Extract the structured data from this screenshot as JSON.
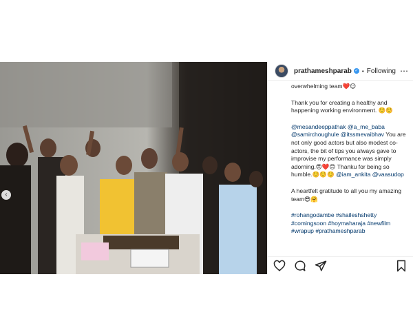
{
  "header": {
    "username": "prathameshparab",
    "dot": "•",
    "follow_label": "Following",
    "more_label": "⋯",
    "verified_glyph": "✓"
  },
  "media": {
    "prev_arrow": "‹"
  },
  "caption": {
    "line1": "overwhelming team❤️😊",
    "para2": "Thank you for creating a healthy and happening working environment. ☺️☺️",
    "mention1": "@mesandeeppathak",
    "mention2": "@a_me_baba",
    "mention3": "@samirchoughule",
    "mention4": "@itssmevaibhav",
    "para3_text": "You are not only good actors but also modest co-actors, the bit of tips you always gave to improvise my performance was simply adorning.😍❤️😊 Thanku for being so humble.☺️☺️☺️",
    "mention5": "@iam_ankita",
    "mention6": "@vaasudop",
    "para4": "A heartfelt gratitude to all you my amazing team😎🤗",
    "tag1": "#rohangodambe",
    "tag2": "#shaileshshetty",
    "tag3": "#comingsoon",
    "tag4": "#hoymaharaja",
    "tag5": "#newfilm",
    "tag6": "#wrapup",
    "tag7": "#prathameshparab"
  },
  "icons": {
    "like": "heart-icon",
    "comment": "comment-icon",
    "share": "share-icon",
    "save": "bookmark-icon"
  }
}
